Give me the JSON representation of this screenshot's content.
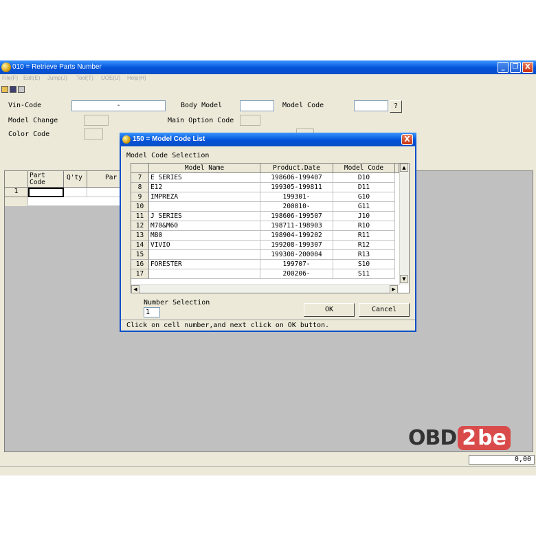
{
  "window": {
    "title": "010 = Retrieve Parts Number",
    "minimize": "_",
    "restore": "❐",
    "close": "X"
  },
  "menu": [
    "File(F)",
    "Edit(E)",
    "Jump(J)",
    "Tool(T)",
    "UOE(U)",
    "Help(H)"
  ],
  "form": {
    "vin_label": "Vin-Code",
    "vin_value": "-",
    "body_model_label": "Body Model",
    "model_code_label": "Model Code",
    "model_code_btn": "?",
    "model_change_label": "Model Change",
    "main_option_label": "Main Option Code",
    "color_code_label": "Color Code"
  },
  "parts_grid": {
    "col_part_code": "Part Code",
    "col_qty": "Q'ty",
    "col_part": "Par",
    "row1": "1"
  },
  "amount": "0,00",
  "dialog": {
    "title": "150 = Model Code List",
    "close": "X",
    "section_label": "Model Code Selection",
    "columns": [
      "Model Name",
      "Product.Date",
      "Model Code"
    ],
    "rows": [
      {
        "num": "7",
        "name": "E SERIES",
        "date": "198606-199407",
        "code": "D10"
      },
      {
        "num": "8",
        "name": "E12",
        "date": "199305-199811",
        "code": "D11"
      },
      {
        "num": "9",
        "name": "IMPREZA",
        "date": "199301-",
        "code": "G10"
      },
      {
        "num": "10",
        "name": "",
        "date": "200010-",
        "code": "G11"
      },
      {
        "num": "11",
        "name": "J SERIES",
        "date": "198606-199507",
        "code": "J10"
      },
      {
        "num": "12",
        "name": "M70&M60",
        "date": "198711-198903",
        "code": "R10"
      },
      {
        "num": "13",
        "name": "M80",
        "date": "198904-199202",
        "code": "R11"
      },
      {
        "num": "14",
        "name": "VIVIO",
        "date": "199208-199307",
        "code": "R12"
      },
      {
        "num": "15",
        "name": "",
        "date": "199308-200004",
        "code": "R13"
      },
      {
        "num": "16",
        "name": "FORESTER",
        "date": "199707-",
        "code": "S10"
      },
      {
        "num": "17",
        "name": "",
        "date": "200206-",
        "code": "S11"
      }
    ],
    "number_selection_label": "Number Selection",
    "number_selection_value": "1",
    "ok": "OK",
    "cancel": "Cancel",
    "hint": "Click on cell number,and next click on OK button."
  },
  "watermark": {
    "obd": "OBD",
    "two": "2",
    "be": "be"
  },
  "colors": {
    "titlebar": "#0a5fe0",
    "window_bg": "#ece9d8",
    "logo_red": "#d94b4b"
  }
}
